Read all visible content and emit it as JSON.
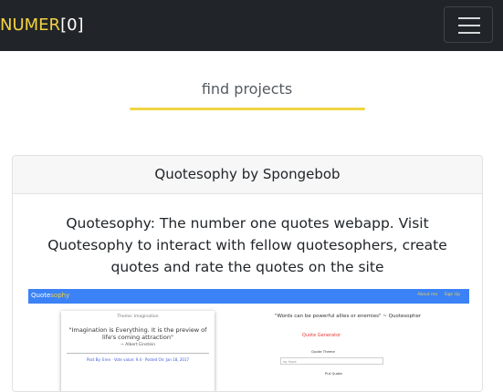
{
  "navbar": {
    "brand_part1": "NUMER",
    "brand_part2": "[0]",
    "menu_icon": "hamburger-icon"
  },
  "section": {
    "title": "find projects"
  },
  "project_card": {
    "header": "Quotesophy by Spongebob",
    "description": "Quotesophy: The number one quotes webapp. Visit Quotesophy to interact with fellow quotesophers, create quotes and rate the quotes on the site"
  },
  "preview": {
    "brand_white": "Quote",
    "brand_yellow": "sophy",
    "links": [
      "About me",
      "Sign Up"
    ],
    "card": {
      "title": "Theme: Imagination",
      "quote": "\"Imagination is Everything. It is the preview of life's coming attraction\"",
      "author": "~ Albert Einstein",
      "meta": "Post By: Eren · Vote value: 9.4 · Posted On: Jan 18, 2017"
    },
    "tagline": "\"Words can be powerful allies or enemies\" ~ Quotesopher",
    "generator_title": "Quote Generator",
    "label_theme": "Quote Theme",
    "theme_placeholder": "eg Hope",
    "label_quote": "Put Quote"
  },
  "colors": {
    "navbar_bg": "#212529",
    "brand_accent": "#f5d142",
    "underline": "#f1d545",
    "preview_nav": "#3b82f6"
  }
}
